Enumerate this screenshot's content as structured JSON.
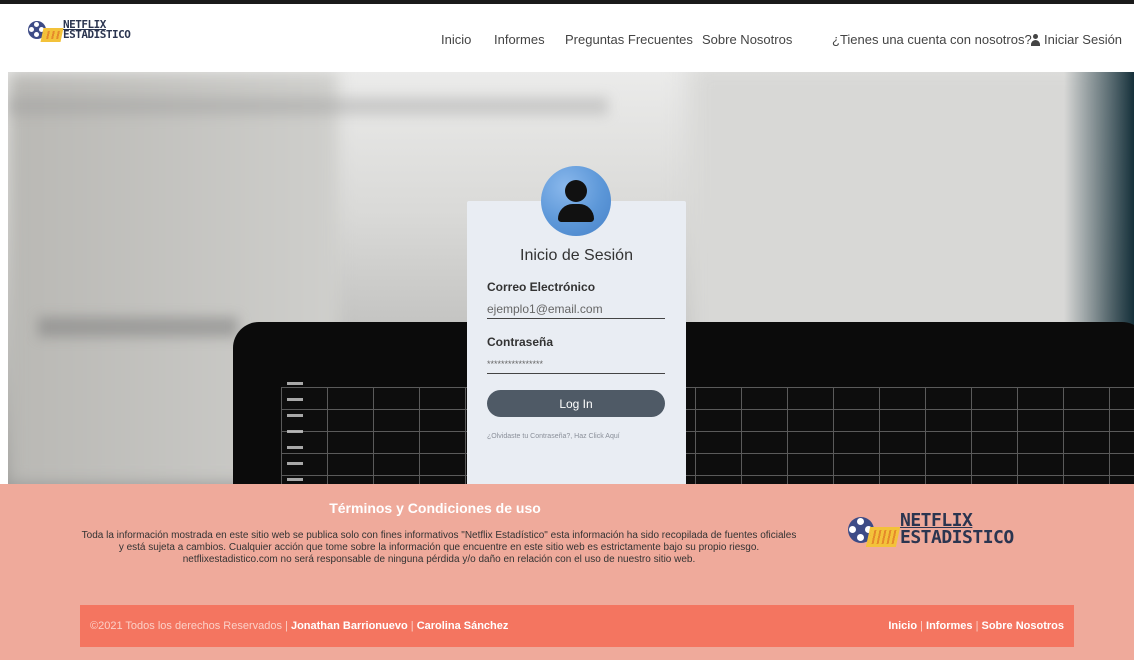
{
  "brand": {
    "line1": "NETFLIX",
    "line2": "ESTADISTICO"
  },
  "nav": {
    "home": "Inicio",
    "reports": "Informes",
    "faq": "Preguntas Frecuentes",
    "about": "Sobre Nosotros",
    "account_question": "¿Tienes una cuenta con nosotros?",
    "login": "Iniciar Sesión"
  },
  "login_form": {
    "title": "Inicio de Sesión",
    "email_label": "Correo Electrónico",
    "email_placeholder": "ejemplo1@email.com",
    "password_label": "Contraseña",
    "password_placeholder": "****************",
    "submit": "Log In",
    "forgot": "¿Olvidaste tu Contraseña?, Haz Click Aquí"
  },
  "footer": {
    "terms_title": "Términos y Condiciones de uso",
    "terms_text": "Toda la información mostrada en este sitio web se publica solo con fines informativos \"Netflix Estadístico\" esta información ha sido recopilada de fuentes oficiales y está sujeta a cambios. Cualquier acción que tome sobre la información que encuentre en este sitio web es estrictamente bajo su propio riesgo. netflixestadistico.com no será responsable de ninguna pérdida y/o daño en relación con el uso de nuestro sitio web.",
    "copyright": "©2021 Todos los derechos Reservados",
    "author1": "Jonathan Barrionuevo",
    "author2": "Carolina Sánchez",
    "separator": "|",
    "links": {
      "home": "Inicio",
      "reports": "Informes",
      "about": "Sobre Nosotros"
    }
  },
  "colors": {
    "footer_bg": "#efaa9b",
    "copy_bar": "#f47560",
    "button": "#4f5a66",
    "avatar": "#5c97d8",
    "card": "#e9edf3"
  }
}
